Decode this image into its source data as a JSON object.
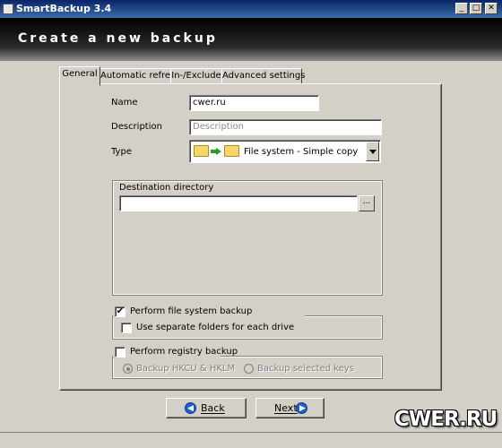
{
  "window": {
    "title": "SmartBackup 3.4",
    "minimize": "_",
    "maximize": "□",
    "close": "✕"
  },
  "header": {
    "title": "Create a new backup"
  },
  "tabs": [
    {
      "label": "General",
      "active": true
    },
    {
      "label": "Automatic refresh",
      "active": false
    },
    {
      "label": "In-/Exclude",
      "active": false
    },
    {
      "label": "Advanced settings",
      "active": false
    }
  ],
  "form": {
    "name_label": "Name",
    "name_value": "cwer.ru",
    "description_label": "Description",
    "description_placeholder": "Description",
    "type_label": "Type",
    "type_value": "File system - Simple copy"
  },
  "destination": {
    "label": "Destination directory",
    "value": "",
    "browse_label": "..."
  },
  "options": {
    "perform_fs_backup": {
      "label": "Perform file system backup",
      "checked": true
    },
    "separate_folders": {
      "label": "Use separate folders for each drive",
      "checked": false
    },
    "perform_registry_backup": {
      "label": "Perform registry backup",
      "checked": false
    },
    "backup_hkcu_hklm": {
      "label": "Backup HKCU & HKLM",
      "selected": true,
      "enabled": false
    },
    "backup_selected_keys": {
      "label": "Backup selected keys",
      "selected": false,
      "enabled": false
    }
  },
  "buttons": {
    "back": "Back",
    "next": "Next",
    "back_icon": "◀",
    "next_icon": "▶"
  },
  "check_mark": "✔",
  "watermark": "CWER.RU",
  "colors": {
    "titlebar": "#0a246a",
    "dialog_bg": "#d4d0c8",
    "button_icon": "#1e5fd0",
    "folder": "#f5d66a",
    "arrow": "#22a022"
  }
}
